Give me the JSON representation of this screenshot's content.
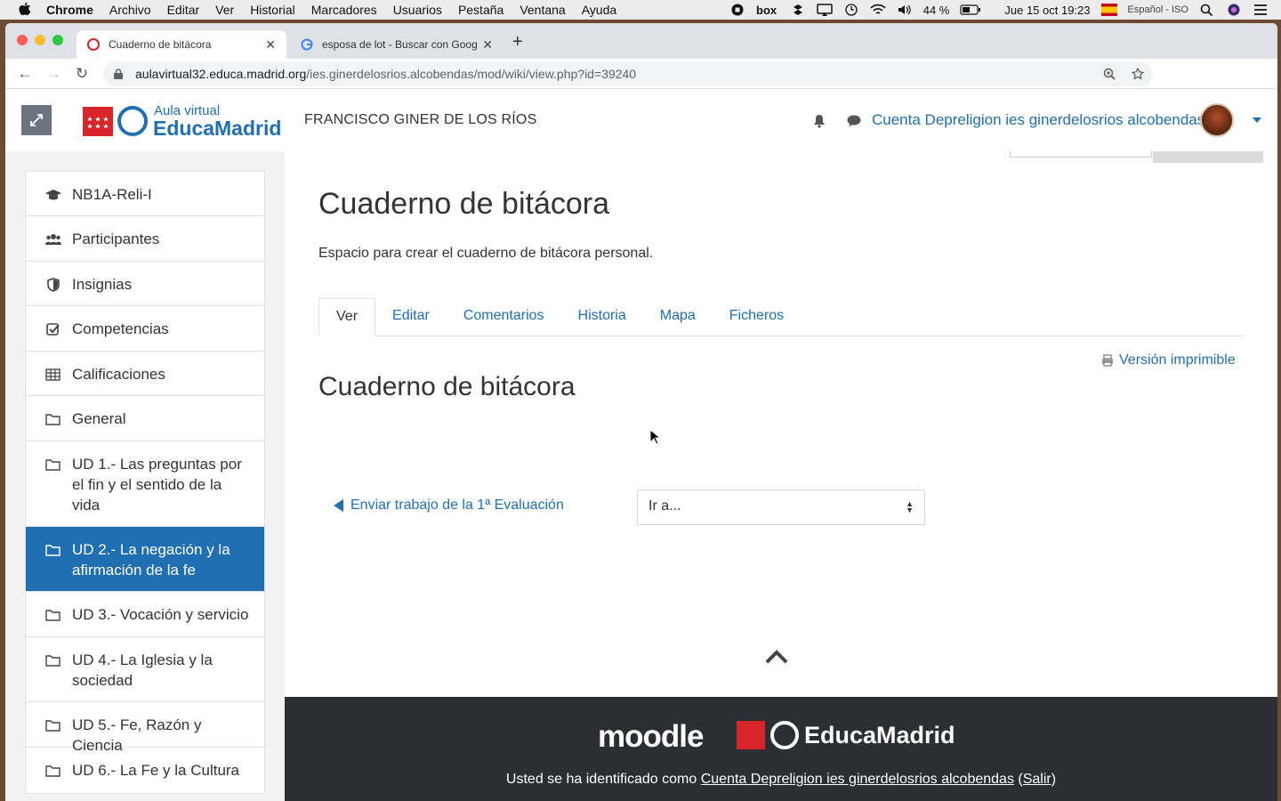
{
  "menubar": {
    "app": "Chrome",
    "items": [
      "Archivo",
      "Editar",
      "Ver",
      "Historial",
      "Marcadores",
      "Usuarios",
      "Pestaña",
      "Ventana",
      "Ayuda"
    ],
    "battery": "44 %",
    "datetime": "Jue 15 oct 19:23",
    "input_source": "Español - ISO"
  },
  "browser": {
    "tabs": [
      {
        "title": "Cuaderno de bitácora",
        "active": true
      },
      {
        "title": "esposa de lot - Buscar con Google",
        "active": false
      }
    ],
    "url_host": "aulavirtual32.educa.madrid.org",
    "url_path": "/ies.ginerdelosrios.alcobendas/mod/wiki/view.php?id=39240"
  },
  "header": {
    "logo_small": "Aula virtual",
    "logo_big": "EducaMadrid",
    "site_name": "FRANCISCO GINER DE LOS RÍOS",
    "user_name": "Cuenta Depreligion ies ginerdelosrios alcobendas"
  },
  "sidebar": {
    "items": [
      {
        "label": "NB1A-Reli-I",
        "icon": "graduation-cap-icon"
      },
      {
        "label": "Participantes",
        "icon": "users-icon"
      },
      {
        "label": "Insignias",
        "icon": "shield-icon"
      },
      {
        "label": "Competencias",
        "icon": "check-square-icon"
      },
      {
        "label": "Calificaciones",
        "icon": "table-icon"
      },
      {
        "label": "General",
        "icon": "folder-icon"
      },
      {
        "label": "UD 1.- Las preguntas por el fin y el sentido de la vida",
        "icon": "folder-icon"
      },
      {
        "label": "UD 2.- La negación y la afirmación de la fe",
        "icon": "folder-icon",
        "active": true
      },
      {
        "label": "UD 3.- Vocación y servicio",
        "icon": "folder-icon"
      },
      {
        "label": "UD 4.- La Iglesia y la sociedad",
        "icon": "folder-icon"
      },
      {
        "label": "UD 5.- Fe, Razón y Ciencia",
        "icon": "folder-icon"
      },
      {
        "label": "UD 6.- La Fe y la Cultura",
        "icon": "folder-icon"
      }
    ]
  },
  "main": {
    "title": "Cuaderno de bitácora",
    "intro": "Espacio para crear el cuaderno de bitácora personal.",
    "tabs": [
      "Ver",
      "Editar",
      "Comentarios",
      "Historia",
      "Mapa",
      "Ficheros"
    ],
    "printable": "Versión imprimible",
    "page_title": "Cuaderno de bitácora",
    "prev_activity": "Enviar trabajo de la 1ª Evaluación",
    "jump_to": "Ir a..."
  },
  "footer": {
    "moodle": "moodle",
    "brand": "EducaMadrid",
    "logged_in_prefix": "Usted se ha identificado como ",
    "logged_in_user": "Cuenta Depreligion ies ginerdelosrios alcobendas",
    "logout": "Salir"
  },
  "colors": {
    "accent": "#1f6fb2",
    "footer_bg": "#2b2f33",
    "brand_red": "#d9252a"
  }
}
